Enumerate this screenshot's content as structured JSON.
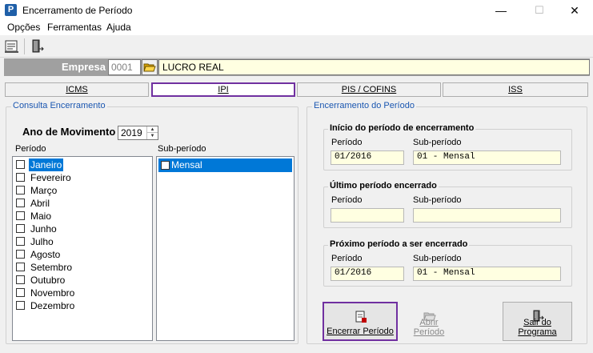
{
  "window": {
    "title": "Encerramento de Período",
    "app_icon_letter": "P",
    "minimize": "—",
    "maximize": "☐",
    "close": "✕"
  },
  "menu": [
    "Opções",
    "Ferramentas",
    "Ajuda"
  ],
  "empresa": {
    "label": "Empresa",
    "code": "0001",
    "name": "LUCRO REAL"
  },
  "tabs": [
    {
      "label": "ICMS",
      "active": false
    },
    {
      "label": "IPI",
      "active": true
    },
    {
      "label": "PIS / COFINS",
      "active": false
    },
    {
      "label": "ISS",
      "active": false
    }
  ],
  "consulta": {
    "title": "Consulta Encerramento",
    "ano_label": "Ano de Movimento",
    "ano_value": "2019",
    "periodo_header": "Período",
    "subperiodo_header": "Sub-período",
    "periodos": [
      "Janeiro",
      "Fevereiro",
      "Março",
      "Abril",
      "Maio",
      "Junho",
      "Julho",
      "Agosto",
      "Setembro",
      "Outubro",
      "Novembro",
      "Dezembro"
    ],
    "selected_periodo": "Janeiro",
    "subperiodos": [
      "Mensal"
    ]
  },
  "encerramento": {
    "title": "Encerramento do Período",
    "inicio": {
      "title": "Início do período de encerramento",
      "periodo_label": "Período",
      "subperiodo_label": "Sub-período",
      "periodo": "01/2016",
      "subperiodo": "01 - Mensal"
    },
    "ultimo": {
      "title": "Último período encerrado",
      "periodo_label": "Período",
      "subperiodo_label": "Sub-período",
      "periodo": "",
      "subperiodo": ""
    },
    "proximo": {
      "title": "Próximo período a ser encerrado",
      "periodo_label": "Período",
      "subperiodo_label": "Sub-período",
      "periodo": "01/2016",
      "subperiodo": "01 - Mensal"
    }
  },
  "buttons": {
    "encerrar": "Encerrar Período",
    "abrir": "Abrir Período",
    "sair": "Sair do Programa"
  },
  "colors": {
    "highlight": "#7030a0",
    "selection": "#0078d7",
    "field_bg": "#ffffe1",
    "group_title": "#1a56b0"
  }
}
